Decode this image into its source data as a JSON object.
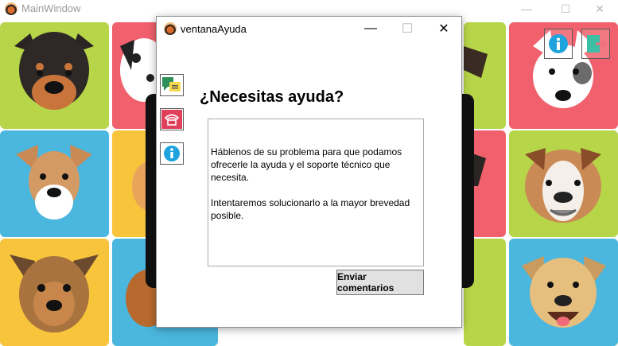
{
  "main_window": {
    "title": "MainWindow",
    "controls": {
      "minimize": "—",
      "maximize": "☐",
      "close": "✕"
    },
    "tile_colors": [
      "#b7d548",
      "#f0616d",
      "#4bb6de",
      "#f7c43c"
    ],
    "corner_icons": [
      "info-icon",
      "exit-door-icon"
    ]
  },
  "dialog": {
    "title": "ventanaAyuda",
    "controls": {
      "minimize": "—",
      "maximize": "☐",
      "close": "✕"
    },
    "side_icons": [
      "chat-icon",
      "phone-icon",
      "info-icon"
    ],
    "heading": "¿Necesitas ayuda?",
    "paragraph_1": "Háblenos de su problema para que podamos ofrecerle la ayuda y el soporte técnico que necesita.",
    "paragraph_2": "Intentaremos solucionarlo a la mayor brevedad posible.",
    "send_button": "Enviar comentarios"
  }
}
